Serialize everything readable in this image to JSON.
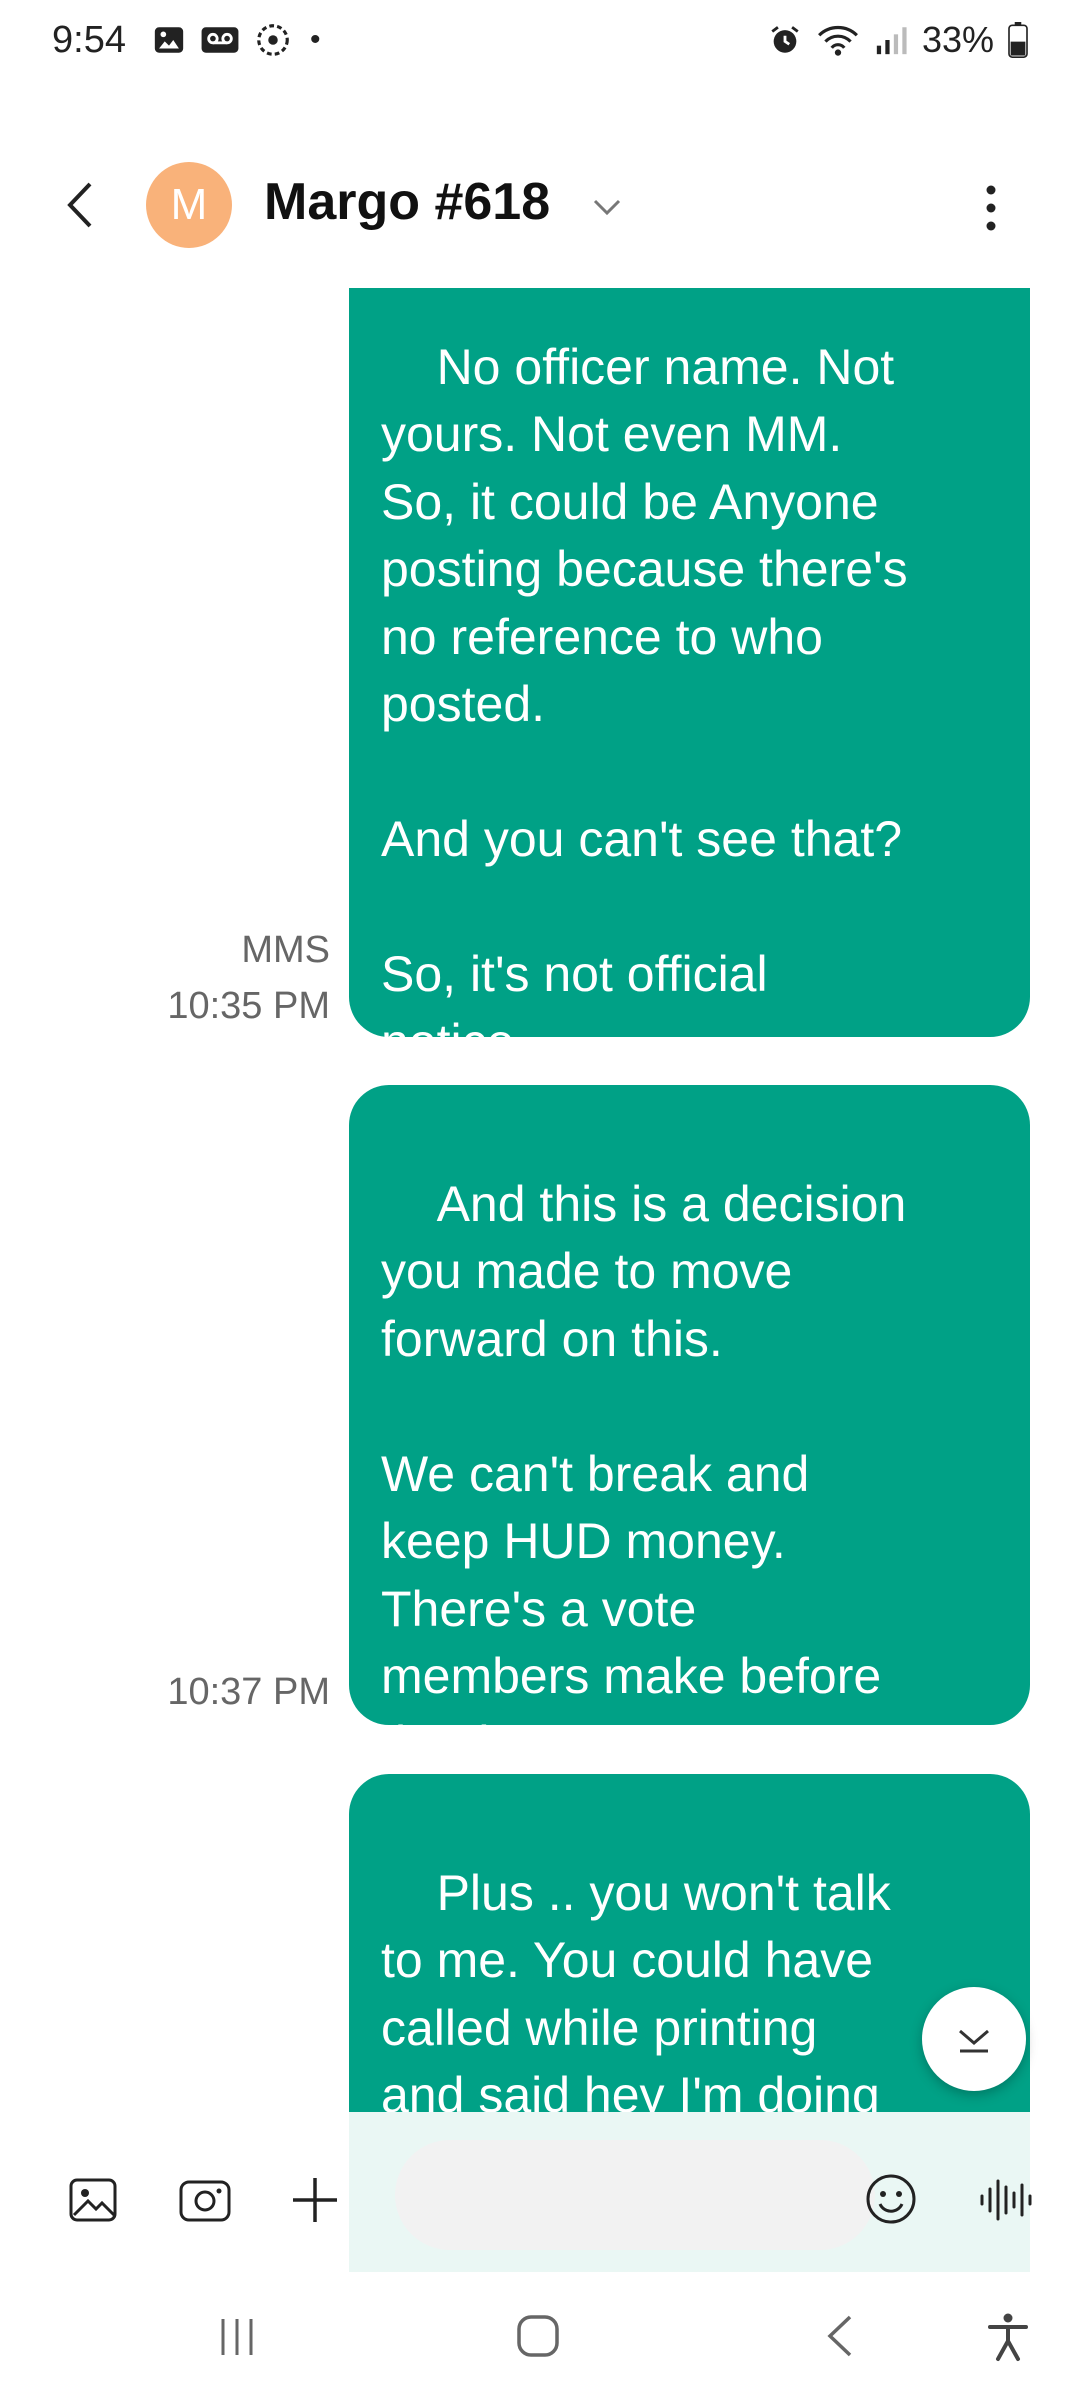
{
  "status_bar": {
    "time": "9:54",
    "battery": "33%",
    "icons": [
      "gallery-icon",
      "voicemail-icon",
      "sync-icon",
      "dot-icon",
      "alarm-icon",
      "wifi-icon",
      "signal-icon",
      "battery-icon"
    ]
  },
  "header": {
    "avatar_initial": "M",
    "contact_name": "Margo #618",
    "avatar_color": "#f9b27a"
  },
  "messages": [
    {
      "text": "No officer name. Not\nyours. Not even MM.\nSo, it could be Anyone\nposting because there's\nno reference to who\nposted.\n\nAnd you can't see that?\n\nSo, it's not official\nnotice.",
      "type": "MMS",
      "time": "10:35 PM"
    },
    {
      "text": "And this is a decision\nyou made to move\nforward on this.\n\nWe can't break and\nkeep HUD money.\nThere's a vote\nmembers make before\nthat happens.",
      "time": "10:37 PM"
    },
    {
      "text": "Plus .. you won't talk\nto me. You could have\ncalled while printing\nand said hey I'm doing\nthis but you didn't.\n\nYou chose to just post"
    }
  ],
  "composer": {
    "placeholder": ""
  },
  "colors": {
    "bubble": "#00a186",
    "background": "#ffffff"
  }
}
